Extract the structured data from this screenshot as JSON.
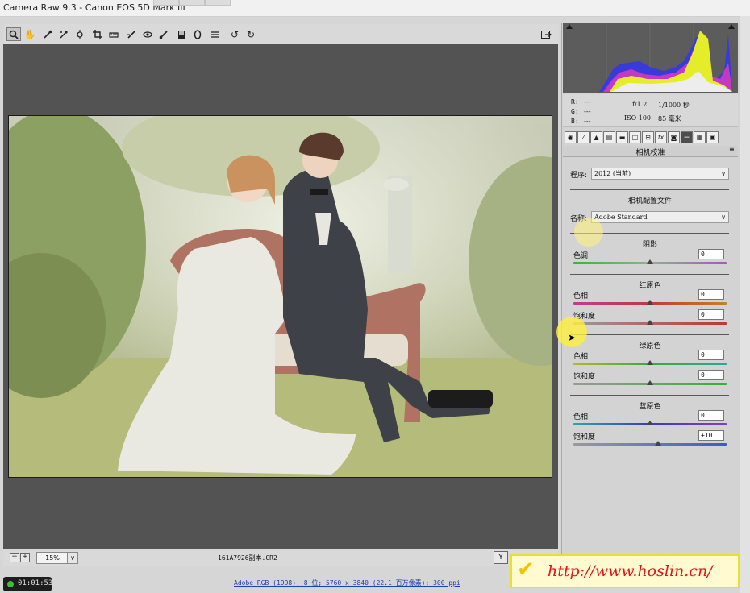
{
  "window": {
    "title": "Camera Raw 9.3 -  Canon EOS 5D Mark III"
  },
  "toolbar": {
    "tools": [
      "zoom-tool",
      "hand-tool",
      "white-balance-tool",
      "color-sampler-tool",
      "crop-tool",
      "straighten-tool",
      "spot-removal-tool",
      "red-eye-tool",
      "adjustment-brush-tool",
      "graduated-filter-tool",
      "radial-filter-tool",
      "preferences-tool",
      "rotate-left-tool",
      "rotate-right-tool"
    ],
    "fullscreen_icon": "fullscreen-icon"
  },
  "info": {
    "r_label": "R:",
    "g_label": "G:",
    "b_label": "B:",
    "r_value": "---",
    "g_value": "---",
    "b_value": "---",
    "aperture": "f/1.2",
    "shutter": "1/1000 秒",
    "iso": "ISO 100",
    "focal": "85 毫米"
  },
  "panel": {
    "title": "相机校准",
    "process_label": "程序:",
    "process_value": "2012 (当前)",
    "profile_section": "相机配置文件",
    "name_label": "名称:",
    "name_value": "Adobe Standard",
    "shadows_title": "阴影",
    "tint_label": "色调",
    "tint_value": "0",
    "red_title": "红原色",
    "red_hue_label": "色相",
    "red_hue_value": "0",
    "red_sat_label": "饱和度",
    "red_sat_value": "0",
    "green_title": "绿原色",
    "green_hue_label": "色相",
    "green_hue_value": "0",
    "green_sat_label": "饱和度",
    "green_sat_value": "0",
    "blue_title": "蓝原色",
    "blue_hue_label": "色相",
    "blue_hue_value": "0",
    "blue_sat_label": "饱和度",
    "blue_sat_value": "+10"
  },
  "status": {
    "zoom": "15%",
    "filename": "161A7926副本.CR2",
    "workflow": "Adobe RGB (1998); 8 位; 5760 x 3840 (22.1 百万像素); 300 ppi",
    "timer": "01:01:53"
  },
  "watermark": {
    "text": "http://www.hoslin.cn/"
  }
}
